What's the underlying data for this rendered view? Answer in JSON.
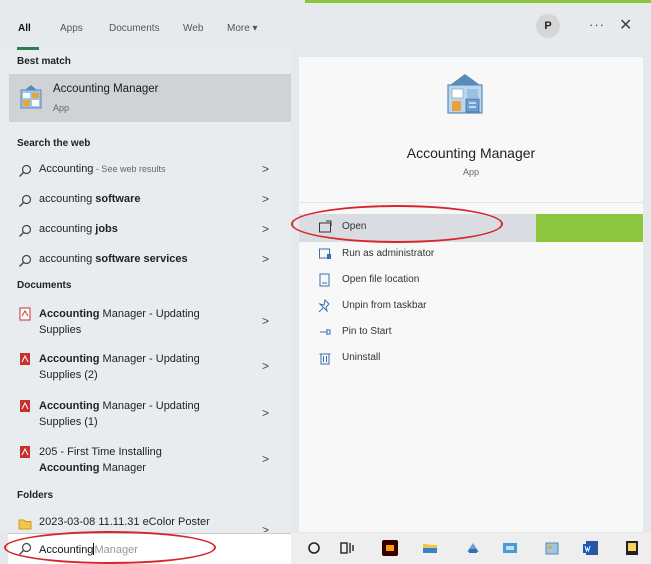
{
  "tabs": [
    {
      "label": "All",
      "active": true
    },
    {
      "label": "Apps"
    },
    {
      "label": "Documents"
    },
    {
      "label": "Web"
    },
    {
      "label": "More ▾"
    }
  ],
  "user_initial": "P",
  "more_label": "···",
  "close_label": "✕",
  "sections": {
    "best_match": "Best match",
    "search_web": "Search the web",
    "documents": "Documents",
    "folders": "Folders"
  },
  "best_match": {
    "title": "Accounting Manager",
    "subtitle": "App"
  },
  "web_results": [
    {
      "prefix": "Accounting",
      "bold": "",
      "hint": " - See web results"
    },
    {
      "prefix": "accounting ",
      "bold": "software",
      "hint": ""
    },
    {
      "prefix": "accounting ",
      "bold": "jobs",
      "hint": ""
    },
    {
      "prefix": "accounting ",
      "bold": "software services",
      "hint": ""
    }
  ],
  "documents": [
    {
      "line1_bold": "Accounting",
      "line1_rest": " Manager - Updating",
      "line2": "Supplies"
    },
    {
      "line1_bold": "Accounting",
      "line1_rest": " Manager - Updating",
      "line2": "Supplies (2)"
    },
    {
      "line1_bold": "Accounting",
      "line1_rest": " Manager - Updating",
      "line2": "Supplies (1)"
    },
    {
      "line1_bold": "",
      "line1_rest": "205 - First Time Installing",
      "line2_bold": "Accounting",
      "line2": " Manager"
    }
  ],
  "folder_item": "2023-03-08 11.11.31 eColor Poster",
  "chevron": ">",
  "detail": {
    "title": "Accounting Manager",
    "subtitle": "App"
  },
  "actions": [
    {
      "label": "Open"
    },
    {
      "label": "Run as administrator"
    },
    {
      "label": "Open file location"
    },
    {
      "label": "Unpin from taskbar"
    },
    {
      "label": "Pin to Start"
    },
    {
      "label": "Uninstall"
    }
  ],
  "search": {
    "typed": "Accounting",
    "suggestion": "Manager"
  },
  "colors": {
    "accent_green": "#8cc63f",
    "annotation_red": "#d7262b",
    "tab_underline": "#2a7f4f"
  }
}
